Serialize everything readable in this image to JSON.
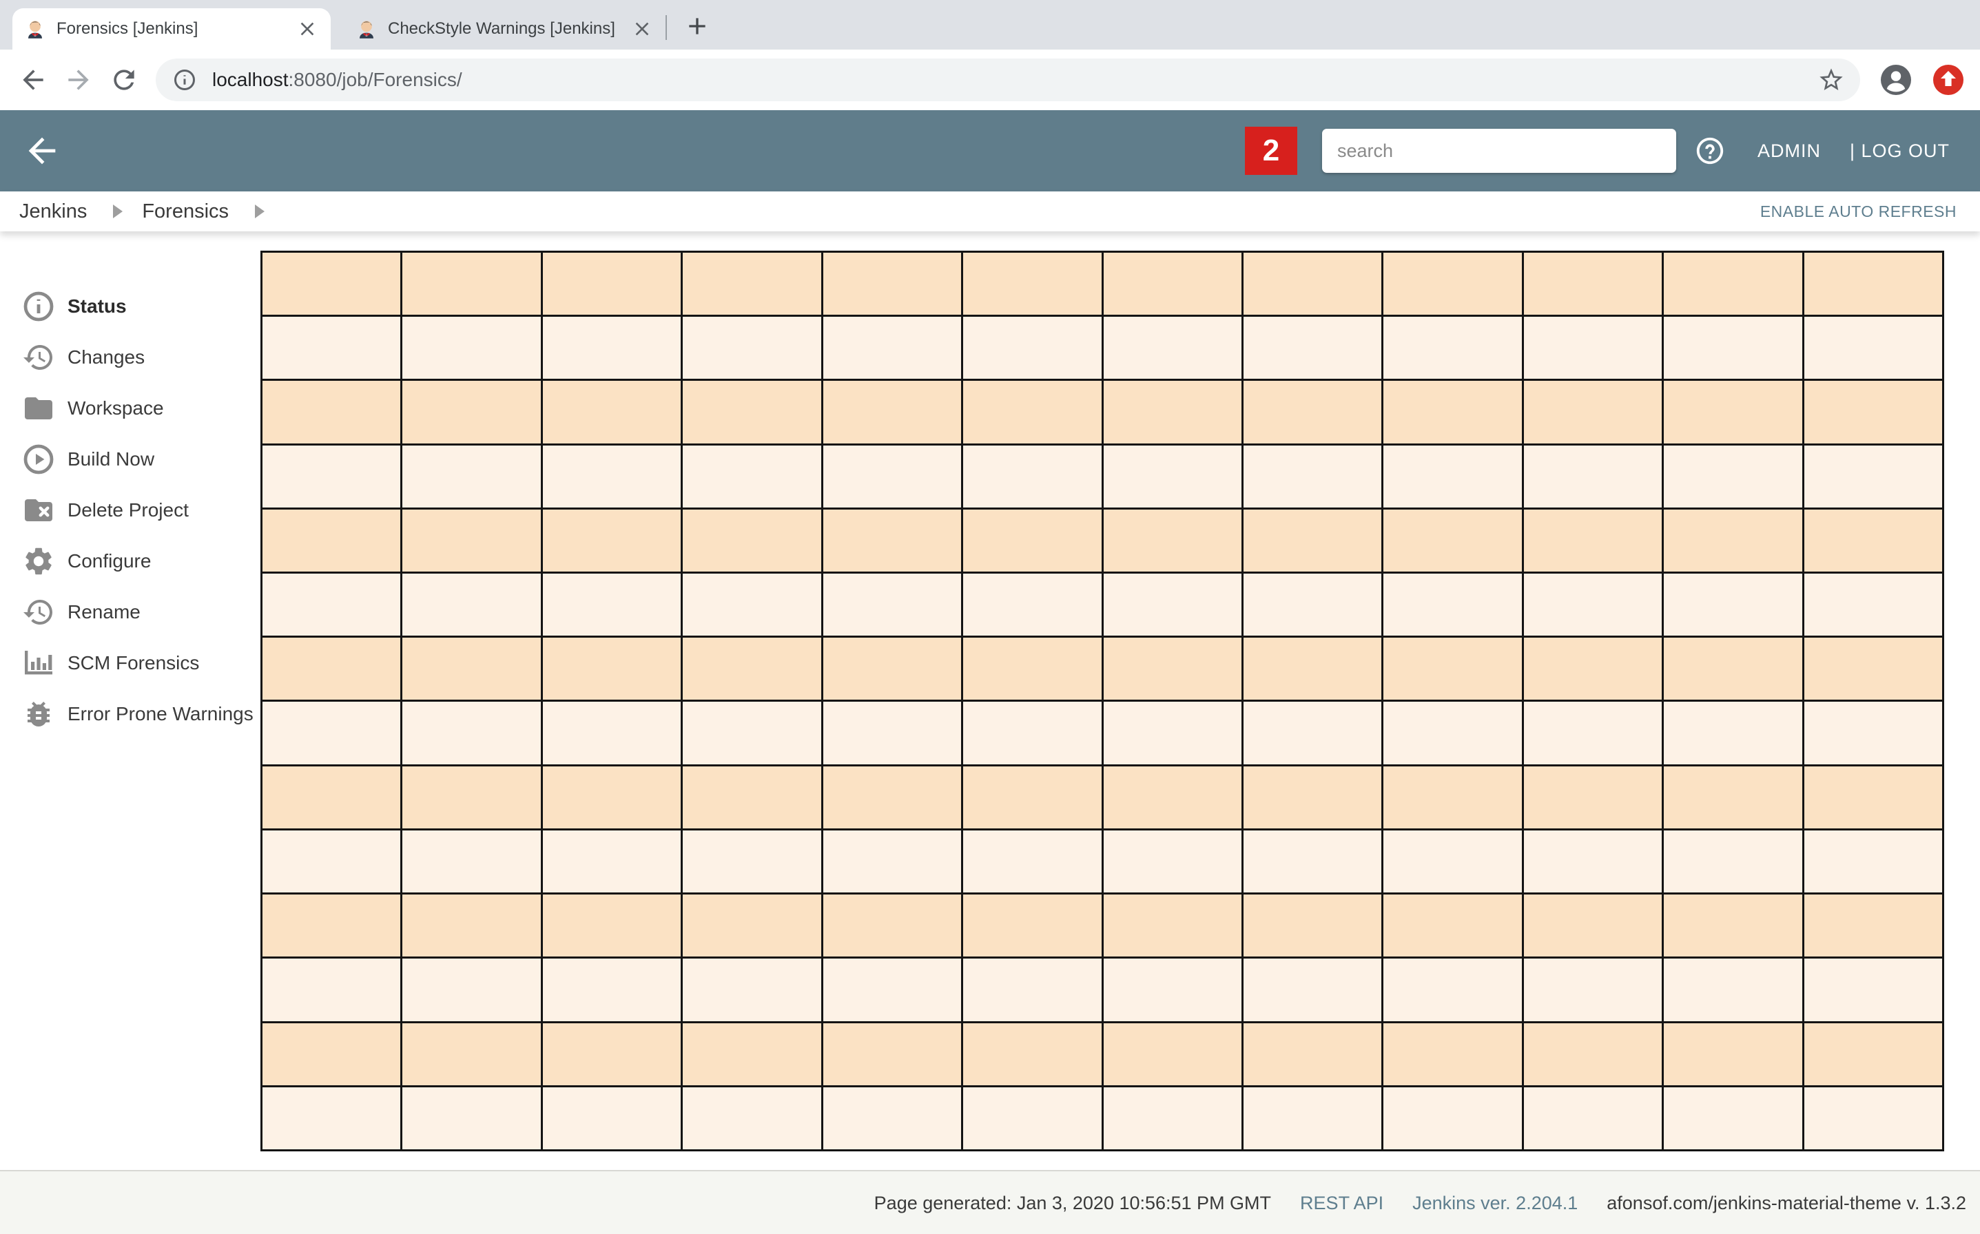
{
  "browser": {
    "tabs": [
      {
        "title": "Forensics [Jenkins]",
        "active": true
      },
      {
        "title": "CheckStyle Warnings [Jenkins]",
        "active": false
      }
    ],
    "url": {
      "host": "localhost",
      "rest": ":8080/job/Forensics/"
    }
  },
  "jenkins_header": {
    "badge_count": "2",
    "search_placeholder": "search",
    "admin_label": "ADMIN",
    "logout_label": "| LOG OUT"
  },
  "breadcrumb": {
    "items": [
      "Jenkins",
      "Forensics"
    ],
    "auto_refresh_label": "ENABLE AUTO REFRESH"
  },
  "sidebar": {
    "items": [
      {
        "label": "Status",
        "icon": "info-circle-icon",
        "bold": true
      },
      {
        "label": "Changes",
        "icon": "history-icon"
      },
      {
        "label": "Workspace",
        "icon": "folder-icon"
      },
      {
        "label": "Build Now",
        "icon": "play-circle-icon"
      },
      {
        "label": "Delete Project",
        "icon": "folder-delete-icon"
      },
      {
        "label": "Configure",
        "icon": "gear-icon"
      },
      {
        "label": "Rename",
        "icon": "history-icon"
      },
      {
        "label": "SCM Forensics",
        "icon": "bar-chart-icon"
      },
      {
        "label": "Error Prone Warnings",
        "icon": "bug-icon"
      }
    ]
  },
  "grid": {
    "columns": 12,
    "rows": 14,
    "row_color_odd": "#fbe2c4",
    "row_color_even": "#fdf2e6",
    "line_color": "#141414"
  },
  "footer": {
    "generated_text": "Page generated: Jan 3, 2020 10:56:51 PM GMT",
    "links": [
      "REST API",
      "Jenkins ver. 2.204.1"
    ],
    "theme_text": "afonsof.com/jenkins-material-theme v. 1.3.2"
  },
  "colors": {
    "header_bg": "#607d8b",
    "badge_bg": "#d7201d",
    "link_color": "#5e7e8e",
    "tabstrip_bg": "#dee1e6"
  }
}
